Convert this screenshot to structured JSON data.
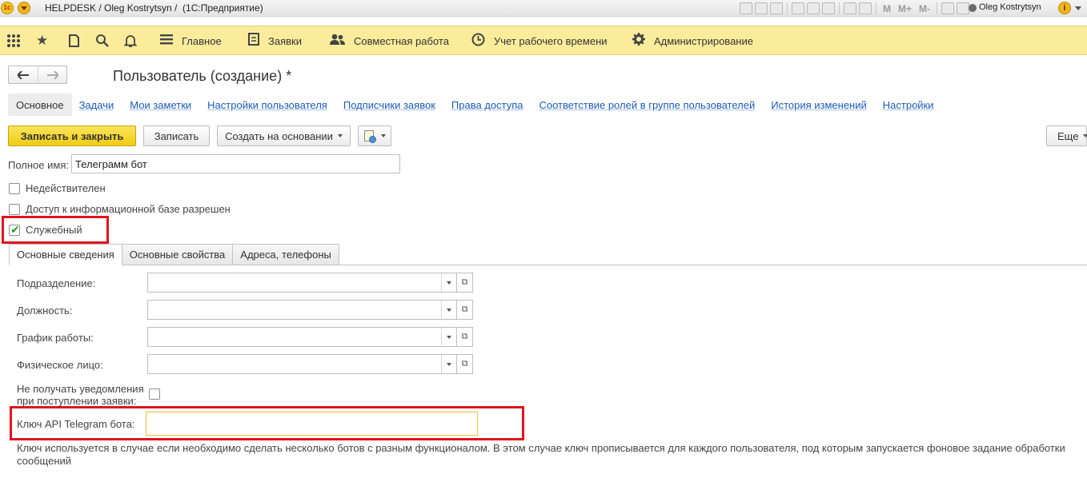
{
  "titlebar": {
    "logo_text": "1с",
    "title": "HELPDESK / Oleg Kostrytsyn /  (1С:Предприятие)",
    "toolbar_text": [
      "M",
      "M+",
      "M-"
    ],
    "user": "Oleg Kostrytsyn",
    "info_glyph": "i"
  },
  "sections": [
    {
      "label": "Главное",
      "icon": "list-icon"
    },
    {
      "label": "Заявки",
      "icon": "document-icon"
    },
    {
      "label": "Совместная работа",
      "icon": "users-icon"
    },
    {
      "label": "Учет рабочего времени",
      "icon": "clock-icon"
    },
    {
      "label": "Администрирование",
      "icon": "gear-icon"
    }
  ],
  "form": {
    "title": "Пользователь (создание) *",
    "tabs_active": "Основное",
    "tabs": [
      "Задачи",
      "Мои заметки",
      "Настройки пользователя",
      "Подписчики заявок",
      "Права доступа",
      "Соответствие ролей в группе пользователей",
      "История изменений",
      "Настройки"
    ]
  },
  "commands": {
    "save_close": "Записать и закрыть",
    "save": "Записать",
    "create_based": "Создать на основании",
    "more": "Еще"
  },
  "fields": {
    "fullname_label": "Полное имя:",
    "fullname_value": "Телеграмм бот",
    "invalid_label": "Недействителен",
    "access_label": "Доступ к информационной базе разрешен",
    "service_label": "Служебный"
  },
  "inner_tabs": [
    "Основные сведения",
    "Основные свойства",
    "Адреса, телефоны"
  ],
  "details": {
    "department_label": "Подразделение:",
    "position_label": "Должность:",
    "schedule_label": "График работы:",
    "person_label": "Физическое лицо:",
    "no_notify_label_1": "Не получать уведомления",
    "no_notify_label_2": "при поступлении заявки:",
    "api_key_label": "Ключ API Telegram бота:",
    "api_key_value": "",
    "note": "Ключ используется в случае если необходимо сделать несколько ботов с разным функционалом. В этом случае ключ прописывается для каждого пользователя, под которым запускается фоновое задание обработки сообщений"
  }
}
